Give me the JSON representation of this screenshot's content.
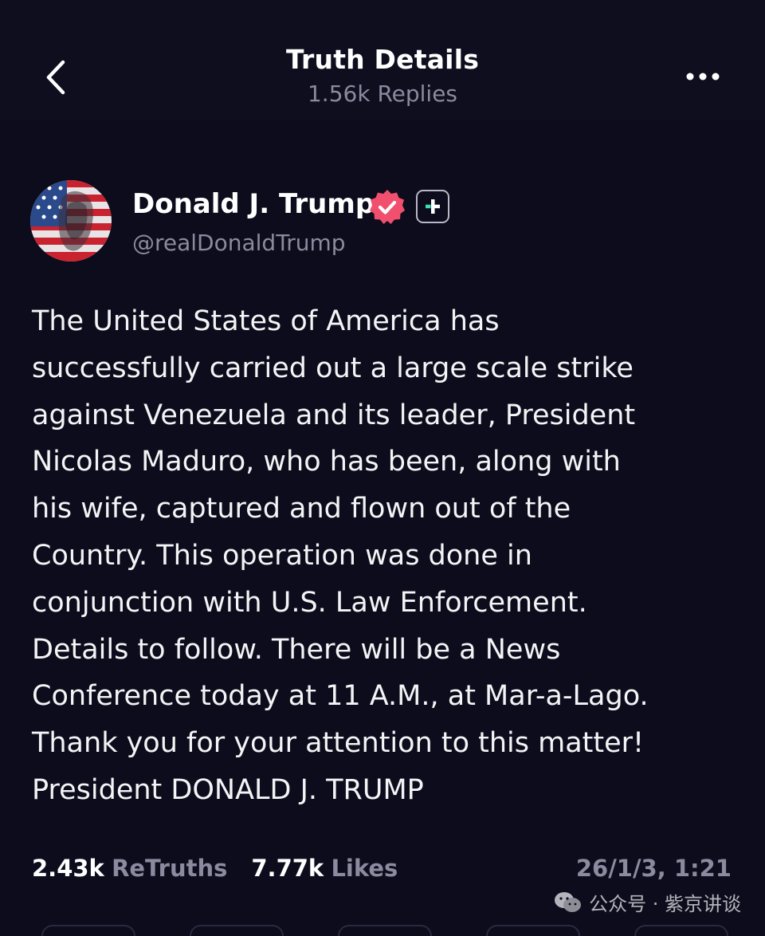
{
  "header": {
    "title": "Truth Details",
    "subtitle": "1.56k Replies",
    "back_icon": "chevron-left-icon",
    "more_icon": "more-horizontal-icon"
  },
  "post": {
    "author_name": "Donald J. Trump",
    "handle": "@realDonaldTrump",
    "verified_color": "#f0506e",
    "body_lines": [
      "The United States of America has",
      "successfully carried out a large scale strike",
      "against Venezuela and its leader, President",
      "Nicolas Maduro, who has been, along with",
      "his wife, captured and flown out of the",
      "Country. This operation was done in",
      "conjunction with U.S. Law Enforcement.",
      "Details to follow. There will be a News",
      "Conference today at 11 A.M., at Mar-a-Lago.",
      "Thank you for your attention to this matter!",
      "President DONALD J. TRUMP"
    ],
    "retruths_count": "2.43k",
    "retruths_label": "ReTruths",
    "likes_count": "7.77k",
    "likes_label": "Likes",
    "timestamp": "26/1/3, 1:21"
  },
  "watermark": {
    "text": "公众号 · 紫京讲谈",
    "icon": "wechat-icon"
  },
  "colors": {
    "background": "#0d0c1c",
    "muted_text": "#8b8a9e",
    "accent": "#f0506e"
  }
}
